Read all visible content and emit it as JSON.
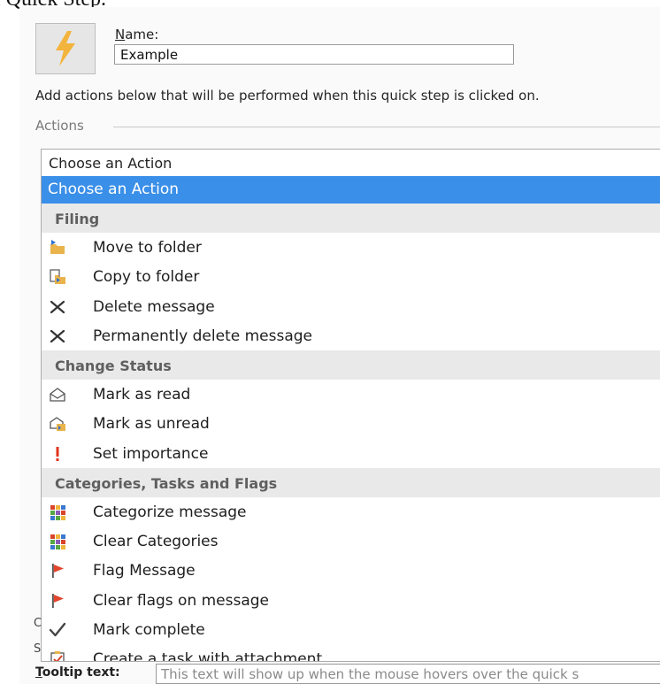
{
  "caption": "l Quick Step.",
  "dialog": {
    "name_label": "Name:",
    "name_value": "Example",
    "instructions": "Add actions below that will be performed when this quick step is clicked on.",
    "actions_label": "Actions",
    "combo_value": "Choose an Action",
    "selected_option": "Choose an Action",
    "tooltip_label": "Tooltip text:",
    "tooltip_value": "This text will show up when the mouse hovers over the quick s",
    "side_glyph_1": "C",
    "side_glyph_2": "S"
  },
  "groups": [
    {
      "title": "Filing",
      "items": [
        {
          "label": "Move to folder",
          "icon": "folder-move-icon"
        },
        {
          "label": "Copy to folder",
          "icon": "copy-folder-icon"
        },
        {
          "label": "Delete message",
          "icon": "delete-x-icon"
        },
        {
          "label": "Permanently delete message",
          "icon": "delete-x-icon"
        }
      ]
    },
    {
      "title": "Change Status",
      "items": [
        {
          "label": "Mark as read",
          "icon": "envelope-open-icon"
        },
        {
          "label": "Mark as unread",
          "icon": "envelope-unread-icon"
        },
        {
          "label": "Set importance",
          "icon": "exclamation-icon"
        }
      ]
    },
    {
      "title": "Categories, Tasks and Flags",
      "items": [
        {
          "label": "Categorize message",
          "icon": "category-grid-icon"
        },
        {
          "label": "Clear Categories",
          "icon": "category-grid-icon"
        },
        {
          "label": "Flag Message",
          "icon": "flag-icon"
        },
        {
          "label": "Clear flags on message",
          "icon": "flag-icon"
        },
        {
          "label": "Mark complete",
          "icon": "checkmark-icon"
        },
        {
          "label": "Create a task with attachment",
          "icon": "task-attachment-icon"
        }
      ]
    }
  ],
  "colors": {
    "selection": "#3a8fe8",
    "group_bg": "#e9e9e9",
    "lightning": "#f2b43c",
    "flag": "#e2452d",
    "importance": "#e0341c"
  }
}
